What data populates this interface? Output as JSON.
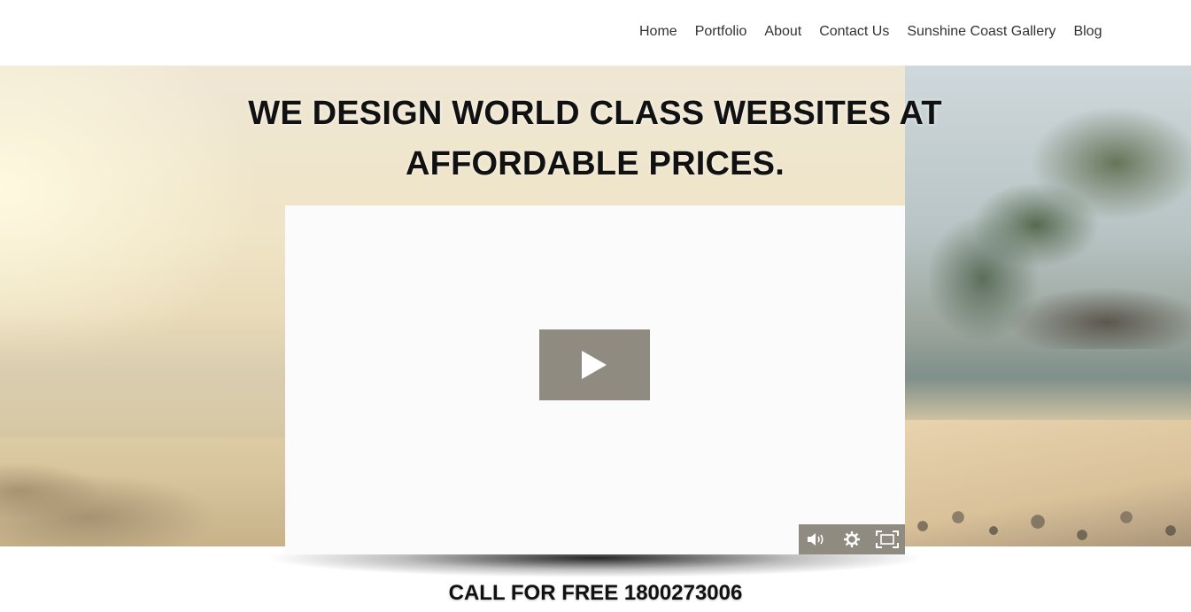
{
  "nav": {
    "items": [
      {
        "label": "Home"
      },
      {
        "label": "Portfolio"
      },
      {
        "label": "About"
      },
      {
        "label": "Contact Us"
      },
      {
        "label": "Sunshine Coast Gallery"
      },
      {
        "label": "Blog"
      }
    ]
  },
  "hero": {
    "headline_line1": "WE DESIGN WORLD CLASS WEBSITES AT",
    "headline_line2": "AFFORDABLE PRICES."
  },
  "video": {
    "play_icon": "play-icon",
    "controls": [
      "volume-icon",
      "settings-icon",
      "fullscreen-icon"
    ],
    "control_color": "#8f8b80"
  },
  "cta": {
    "text": "CALL FOR FREE 1800273006"
  }
}
